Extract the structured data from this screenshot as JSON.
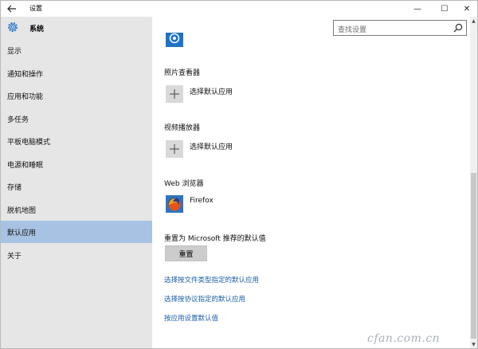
{
  "window": {
    "title": "设置",
    "controls": {
      "minimize": "—",
      "maximize": "☐",
      "close": "✕"
    }
  },
  "sidebar": {
    "title": "系统",
    "items": [
      {
        "label": "显示"
      },
      {
        "label": "通知和操作"
      },
      {
        "label": "应用和功能"
      },
      {
        "label": "多任务"
      },
      {
        "label": "平板电脑模式"
      },
      {
        "label": "电源和睡眠"
      },
      {
        "label": "存储"
      },
      {
        "label": "脱机地图"
      },
      {
        "label": "默认应用",
        "active": true
      },
      {
        "label": "关于"
      }
    ]
  },
  "search": {
    "placeholder": "查找设置"
  },
  "main": {
    "photo_viewer": {
      "title": "照片查看器",
      "choose_label": "选择默认应用"
    },
    "video_player": {
      "title": "视频播放器",
      "choose_label": "选择默认应用"
    },
    "web_browser": {
      "title": "Web 浏览器",
      "app_name": "Firefox"
    },
    "reset": {
      "title": "重置为 Microsoft 推荐的默认值",
      "button_label": "重置"
    },
    "links": [
      "选择按文件类型指定的默认应用",
      "选择按协议指定的默认应用",
      "按应用设置默认值"
    ]
  },
  "watermark": "cfan.com.cn",
  "colors": {
    "sidebar_bg": "#e6e6e6",
    "active_item": "#a7c2e2",
    "link": "#1b5fa8",
    "accent": "#1e73c8"
  }
}
